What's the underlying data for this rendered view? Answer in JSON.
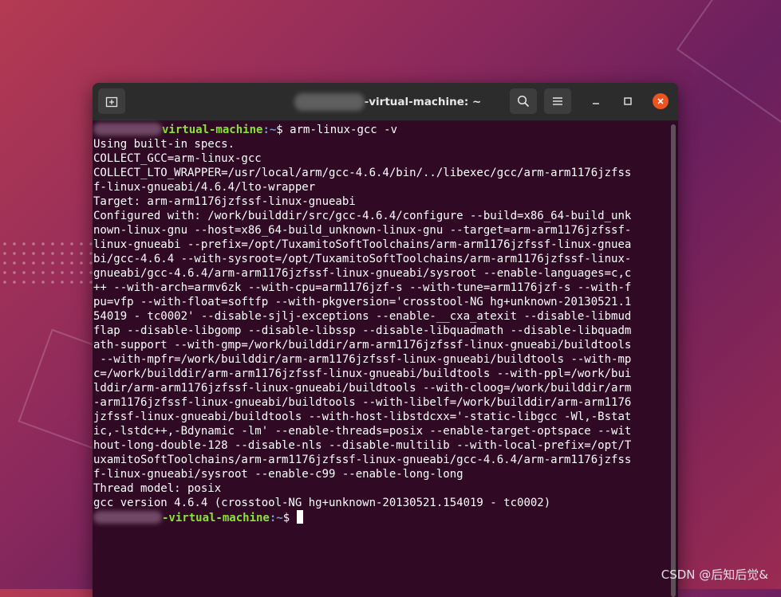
{
  "window": {
    "title_suffix": "-virtual-machine: ~"
  },
  "terminal": {
    "prompt_host_suffix": "virtual-machine",
    "prompt_host_suffix2": "-virtual-machine",
    "prompt_path": ":~",
    "prompt_symbol": "$ ",
    "command": "arm-linux-gcc -v",
    "output_lines": [
      "Using built-in specs.",
      "COLLECT_GCC=arm-linux-gcc",
      "COLLECT_LTO_WRAPPER=/usr/local/arm/gcc-4.6.4/bin/../libexec/gcc/arm-arm1176jzfss",
      "f-linux-gnueabi/4.6.4/lto-wrapper",
      "Target: arm-arm1176jzfssf-linux-gnueabi",
      "Configured with: /work/builddir/src/gcc-4.6.4/configure --build=x86_64-build_unk",
      "nown-linux-gnu --host=x86_64-build_unknown-linux-gnu --target=arm-arm1176jzfssf-",
      "linux-gnueabi --prefix=/opt/TuxamitoSoftToolchains/arm-arm1176jzfssf-linux-gnuea",
      "bi/gcc-4.6.4 --with-sysroot=/opt/TuxamitoSoftToolchains/arm-arm1176jzfssf-linux-",
      "gnueabi/gcc-4.6.4/arm-arm1176jzfssf-linux-gnueabi/sysroot --enable-languages=c,c",
      "++ --with-arch=armv6zk --with-cpu=arm1176jzf-s --with-tune=arm1176jzf-s --with-f",
      "pu=vfp --with-float=softfp --with-pkgversion='crosstool-NG hg+unknown-20130521.1",
      "54019 - tc0002' --disable-sjlj-exceptions --enable-__cxa_atexit --disable-libmud",
      "flap --disable-libgomp --disable-libssp --disable-libquadmath --disable-libquadm",
      "ath-support --with-gmp=/work/builddir/arm-arm1176jzfssf-linux-gnueabi/buildtools",
      " --with-mpfr=/work/builddir/arm-arm1176jzfssf-linux-gnueabi/buildtools --with-mp",
      "c=/work/builddir/arm-arm1176jzfssf-linux-gnueabi/buildtools --with-ppl=/work/bui",
      "lddir/arm-arm1176jzfssf-linux-gnueabi/buildtools --with-cloog=/work/builddir/arm",
      "-arm1176jzfssf-linux-gnueabi/buildtools --with-libelf=/work/builddir/arm-arm1176",
      "jzfssf-linux-gnueabi/buildtools --with-host-libstdcxx='-static-libgcc -Wl,-Bstat",
      "ic,-lstdc++,-Bdynamic -lm' --enable-threads=posix --enable-target-optspace --wit",
      "hout-long-double-128 --disable-nls --disable-multilib --with-local-prefix=/opt/T",
      "uxamitoSoftToolchains/arm-arm1176jzfssf-linux-gnueabi/gcc-4.6.4/arm-arm1176jzfss",
      "f-linux-gnueabi/sysroot --enable-c99 --enable-long-long",
      "Thread model: posix",
      "gcc version 4.6.4 (crosstool-NG hg+unknown-20130521.154019 - tc0002)"
    ]
  },
  "watermark": "CSDN @后知后觉&",
  "icons": {
    "new_tab": "new-tab-icon",
    "search": "search-icon",
    "menu": "hamburger-menu-icon",
    "minimize": "minimize-icon",
    "maximize": "maximize-icon",
    "close": "close-icon"
  },
  "colors": {
    "terminal_bg": "#300a24",
    "prompt_host": "#8ae234",
    "prompt_path": "#729fcf",
    "close_button": "#e95420"
  }
}
